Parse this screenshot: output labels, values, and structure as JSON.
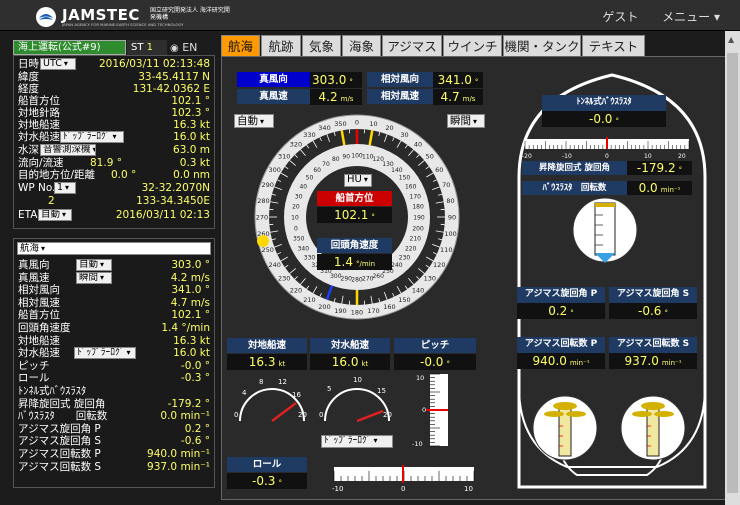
{
  "header": {
    "logo_text": "JAMSTEC",
    "logo_sub": "JAPAN AGENCY FOR MARINE-EARTH SCIENCE AND TECHNOLOGY",
    "logo_jp": "国立研究開発法人 海洋研究開発機構",
    "guest": "ゲスト",
    "menu": "メニュー ▾"
  },
  "status": {
    "mode": "海上運転(公式#9)",
    "st_label": "ST",
    "st_value": "1",
    "lang": "EN"
  },
  "info": {
    "time_label": "日時",
    "time_zone": "UTC",
    "time_value": "2016/03/11 02:13:48",
    "lat_label": "緯度",
    "lat": "33-45.4117 N",
    "lon_label": "経度",
    "lon": "131-42.0362 E",
    "heading_label": "船首方位",
    "heading": "102.1 °",
    "cog_label": "対地針路",
    "cog": "102.3 °",
    "sog_label": "対地船速",
    "sog": "16.3 kt",
    "stw_label": "対水船速",
    "stw_mode": "ﾄﾞｯﾌﾟﾗｰﾛｸﾞ",
    "stw": "16.0 kt",
    "depth_label": "水深",
    "depth_mode": "音響測深機",
    "depth": "63.0 m",
    "current_label": "流向/流速",
    "current_dir": "81.9 °",
    "current_speed": "0.3 kt",
    "dest_label": "目的地方位/距離",
    "dest_dir": "0.0 °",
    "dest_dist": "0.0 nm",
    "wp_label": "WP No.",
    "wp_no": "1",
    "wp_lat": "32-32.2070N",
    "wp_idx": "2",
    "wp_lon": "133-34.3450E",
    "eta_label": "ETA",
    "eta_mode": "自動",
    "eta": "2016/03/11 02:13"
  },
  "nav_list": {
    "category": "航海",
    "items": [
      {
        "label": "真風向",
        "mode": "自動",
        "value": "303.0 °"
      },
      {
        "label": "真風速",
        "mode": "瞬間",
        "value": "4.2 m/s"
      },
      {
        "label": "相対風向",
        "value": "341.0 °"
      },
      {
        "label": "相対風速",
        "value": "4.7 m/s"
      },
      {
        "label": "船首方位",
        "value": "102.1 °"
      },
      {
        "label": "回頭角速度",
        "value": "1.4 °/min"
      },
      {
        "label": "対地船速",
        "value": "16.3 kt"
      },
      {
        "label": "対水船速",
        "mode": "ﾄﾞｯﾌﾟﾗｰﾛｸﾞ",
        "value": "16.0 kt"
      },
      {
        "label": "ピッチ",
        "value": "-0.0 °"
      },
      {
        "label": "ロール",
        "value": "-0.3 °"
      },
      {
        "label": "ﾄﾝﾈﾙ式ﾊﾞｳｽﾗｽﾀ",
        "value": ""
      },
      {
        "label": "昇降旋回式 旋回角",
        "value": "-179.2 °"
      },
      {
        "label": "ﾊﾞｳｽﾗｽﾀ　　回転数",
        "value": "0.0 min⁻¹"
      },
      {
        "label": "アジマス旋回角 P",
        "value": "0.2 °"
      },
      {
        "label": "アジマス旋回角 S",
        "value": "-0.6 °"
      },
      {
        "label": "アジマス回転数 P",
        "value": "940.0 min⁻¹"
      },
      {
        "label": "アジマス回転数 S",
        "value": "937.0 min⁻¹"
      }
    ]
  },
  "tabs": [
    "航海",
    "航跡",
    "気象",
    "海象",
    "アジマス",
    "ウインチ",
    "機関・タンク",
    "テキスト"
  ],
  "wind": {
    "true_dir_label": "真風向",
    "true_dir": "303.0",
    "rel_dir_label": "相対風向",
    "rel_dir": "341.0",
    "true_speed_label": "真風速",
    "true_speed": "4.2",
    "rel_speed_label": "相対風速",
    "rel_speed": "4.7",
    "deg": "°",
    "ms": "m/s",
    "auto": "自動",
    "instant": "瞬間"
  },
  "compass": {
    "mode": "HU",
    "heading_label": "船首方位",
    "heading": "102.1",
    "deg": "°",
    "rot_label": "回頭角速度",
    "rot": "1.4",
    "rot_unit": "°/min"
  },
  "speeds": {
    "sog_label": "対地船速",
    "sog": "16.3",
    "stw_label": "対水船速",
    "stw": "16.0",
    "kt": "kt",
    "pitch_label": "ピッチ",
    "pitch": "-0.0",
    "deg": "°",
    "doppler": "ﾄﾞｯﾌﾟﾗｰﾛｸﾞ"
  },
  "roll": {
    "label": "ロール",
    "value": "-0.3",
    "deg": "°"
  },
  "thruster": {
    "tunnel_label": "ﾄﾝﾈﾙ式ﾊﾞｳｽﾗｽﾀ",
    "tunnel_value": "-0.0",
    "deg": "°",
    "lift_label": "昇降旋回式 旋回角",
    "lift_value": "-179.2",
    "bow_label": "ﾊﾞｳｽﾗｽﾀ　回転数",
    "bow_value": "0.0",
    "min": "min⁻¹"
  },
  "azimuth": {
    "ang_p_label": "アジマス旋回角 P",
    "ang_p": "0.2",
    "ang_s_label": "アジマス旋回角 S",
    "ang_s": "-0.6",
    "rpm_p_label": "アジマス回転数 P",
    "rpm_p": "940.0",
    "rpm_s_label": "アジマス回転数 S",
    "rpm_s": "937.0",
    "deg": "°",
    "min": "min⁻¹"
  }
}
